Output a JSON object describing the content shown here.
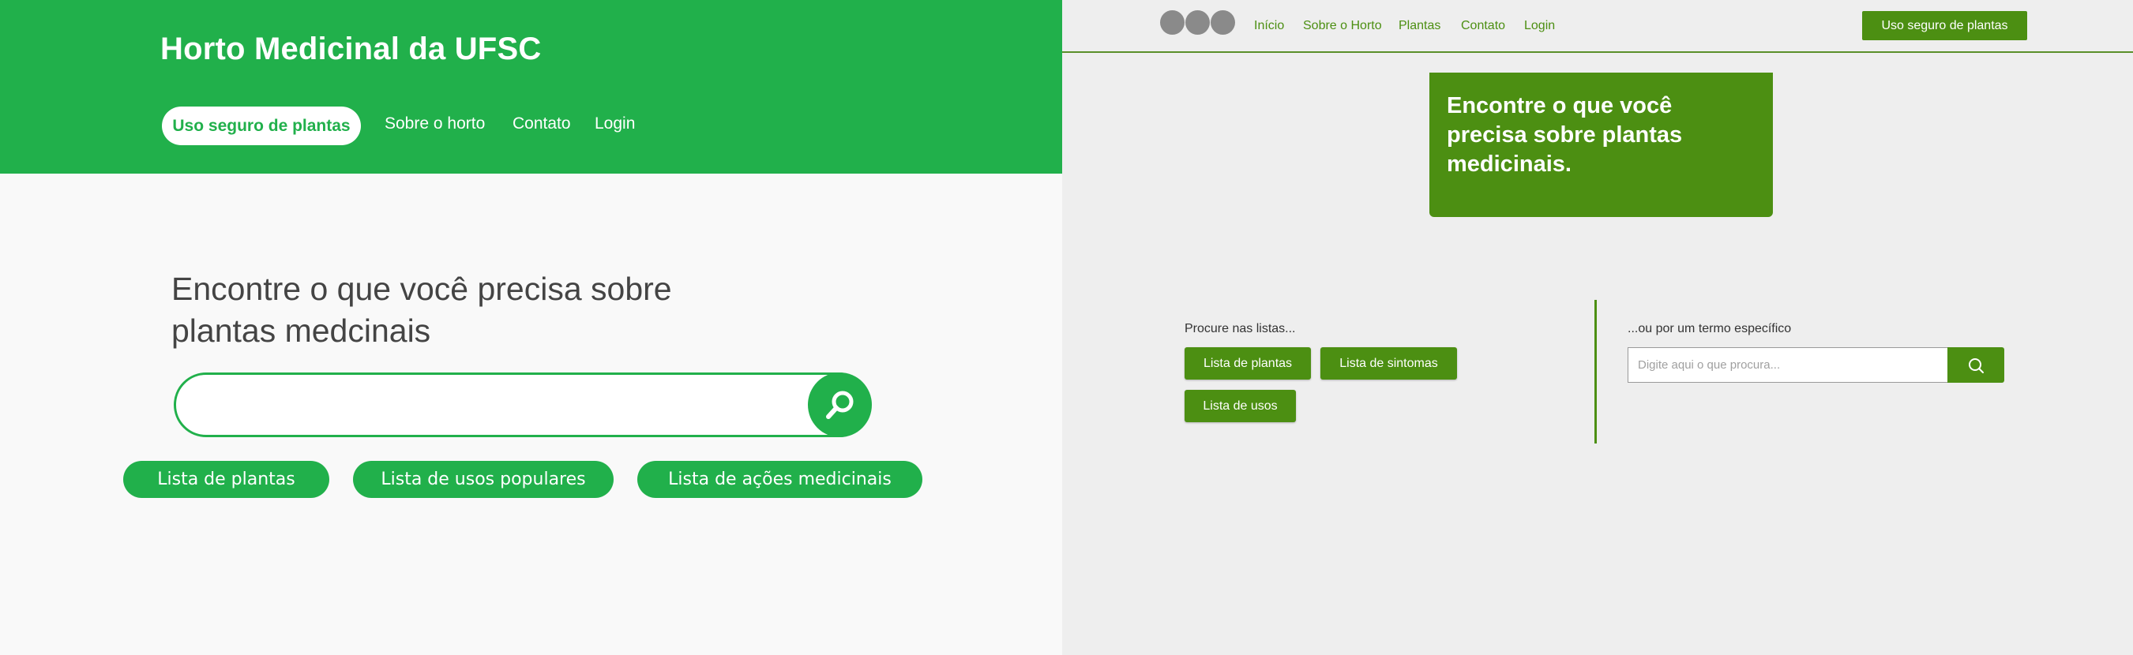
{
  "left": {
    "header": {
      "title": "Horto Medicinal da UFSC",
      "nav": [
        "Uso seguro de plantas",
        "Sobre o horto",
        "Contato",
        "Login"
      ]
    },
    "main": {
      "heading": "Encontre o que você precisa sobre plantas medcinais",
      "search": {
        "value": "",
        "icon": "search-icon"
      },
      "list_buttons": [
        "Lista de plantas",
        "Lista de usos populares",
        "Lista de ações medicinais"
      ]
    },
    "colors": {
      "accent": "#21b04b",
      "background": "#f9f9f9",
      "text": "#444444"
    }
  },
  "right": {
    "topbar": {
      "nav": [
        "Início",
        "Sobre o Horto",
        "Plantas",
        "Contato",
        "Login"
      ],
      "cta": "Uso seguro de plantas"
    },
    "hero": {
      "text": "Encontre o que você precisa sobre plantas medicinais."
    },
    "lists": {
      "label": "Procure nas listas...",
      "buttons": [
        "Lista de plantas",
        "Lista de sintomas",
        "Lista de usos"
      ]
    },
    "search": {
      "label": "...ou por um termo específico",
      "placeholder": "Digite aqui o que procura...",
      "icon": "search-icon"
    },
    "colors": {
      "accent": "#4c8f12",
      "background": "#eeeeee",
      "logo_dots": "#8a8a8a"
    }
  }
}
